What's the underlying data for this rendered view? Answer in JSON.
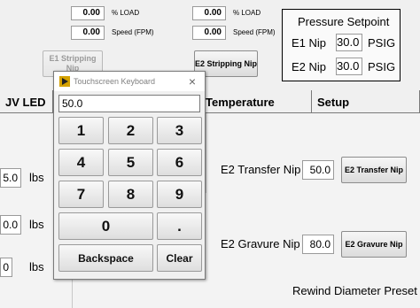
{
  "top_readouts": {
    "e1_load": "0.00",
    "e1_load_unit": "% LOAD",
    "e1_speed": "0.00",
    "e1_speed_unit": "Speed (FPM)",
    "e2_load": "0.00",
    "e2_load_unit": "% LOAD",
    "e2_speed": "0.00",
    "e2_speed_unit": "Speed (FPM)"
  },
  "buttons": {
    "e1_stripping_nip": "E1 Stripping Nip",
    "e2_stripping_nip": "E2 Stripping Nip",
    "e2_transfer_nip": "E2 Transfer Nip",
    "e2_gravure_nip": "E2 Gravure Nip"
  },
  "pressure_setpoint": {
    "title": "Pressure Setpoint",
    "e1_label": "E1 Nip",
    "e1_value": "30.0",
    "e1_unit": "PSIG",
    "e2_label": "E2 Nip",
    "e2_value": "30.0",
    "e2_unit": "PSIG"
  },
  "tabs": {
    "uv_led": "JV LED",
    "temperature": "Temperature",
    "setup": "Setup"
  },
  "left_fields": [
    {
      "value": "5.0",
      "unit": "lbs"
    },
    {
      "value": "0.0",
      "unit": "lbs"
    },
    {
      "value": "0",
      "unit": "lbs"
    }
  ],
  "right_fields": {
    "e2_transfer_nip_label": "E2 Transfer Nip",
    "e2_transfer_nip_value": "50.0",
    "e2_gravure_nip_label": "E2 Gravure Nip",
    "e2_gravure_nip_value": "80.0",
    "rewind_diameter_preset": "Rewind Diameter Preset"
  },
  "keyboard": {
    "title": "Touchscreen Keyboard",
    "close": "×",
    "display_value": "50.0",
    "keys": [
      "1",
      "2",
      "3",
      "4",
      "5",
      "6",
      "7",
      "8",
      "9",
      "0",
      "."
    ],
    "backspace": "Backspace",
    "clear": "Clear"
  },
  "colors": {
    "title_icon": "#d4a100",
    "window_bg": "#f0f0f0"
  }
}
